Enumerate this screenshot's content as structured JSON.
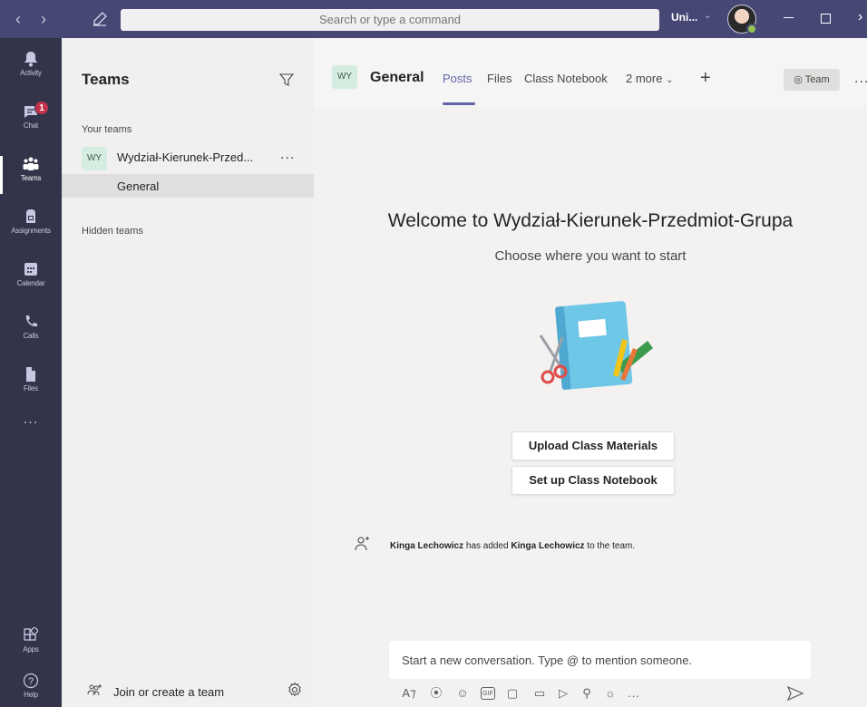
{
  "titlebar": {
    "back_icon": "chevron-left-icon",
    "forward_icon": "chevron-right-icon",
    "search_placeholder": "Search or type a command",
    "org_label": "Uni...",
    "colors": {
      "bar": "#464775",
      "presence": "#92c353"
    }
  },
  "rail": {
    "items": [
      {
        "id": "activity",
        "label": "Activity",
        "icon": "bell-icon"
      },
      {
        "id": "chat",
        "label": "Chat",
        "icon": "chat-icon",
        "badge": "1"
      },
      {
        "id": "teams",
        "label": "Teams",
        "icon": "teams-icon",
        "active": true
      },
      {
        "id": "assignments",
        "label": "Assignments",
        "icon": "assignments-icon"
      },
      {
        "id": "calendar",
        "label": "Calendar",
        "icon": "calendar-icon"
      },
      {
        "id": "calls",
        "label": "Calls",
        "icon": "phone-icon"
      },
      {
        "id": "files",
        "label": "Files",
        "icon": "file-icon"
      }
    ],
    "more": "...",
    "apps_label": "Apps",
    "help_label": "Help",
    "colors": {
      "rail": "#33344a",
      "badge": "#c4314b"
    }
  },
  "panel": {
    "title": "Teams",
    "your_teams_label": "Your teams",
    "team": {
      "avatar": "WY",
      "name": "Wydział-Kierunek-Przed...",
      "more": "..."
    },
    "channel": "General",
    "hidden_teams_label": "Hidden teams",
    "join_label": "Join or create a team"
  },
  "channel": {
    "avatar": "WY",
    "title": "General",
    "tabs": [
      {
        "label": "Posts",
        "active": true
      },
      {
        "label": "Files"
      },
      {
        "label": "Class Notebook"
      },
      {
        "label": "2 more"
      }
    ],
    "team_button": "Team",
    "more": "...",
    "accent": "#6264a7"
  },
  "welcome": {
    "title": "Welcome to Wydział-Kierunek-Przedmiot-Grupa",
    "subtitle": "Choose where you want to start",
    "buttons": [
      "Upload Class Materials",
      "Set up Class Notebook"
    ]
  },
  "activity": {
    "actor": "Kinga Lechowicz",
    "verb": "has added",
    "target": "Kinga Lechowicz",
    "suffix": "to the team."
  },
  "composer": {
    "placeholder": "Start a new conversation. Type @ to mention someone.",
    "gif_label": "GIF",
    "more": "..."
  }
}
